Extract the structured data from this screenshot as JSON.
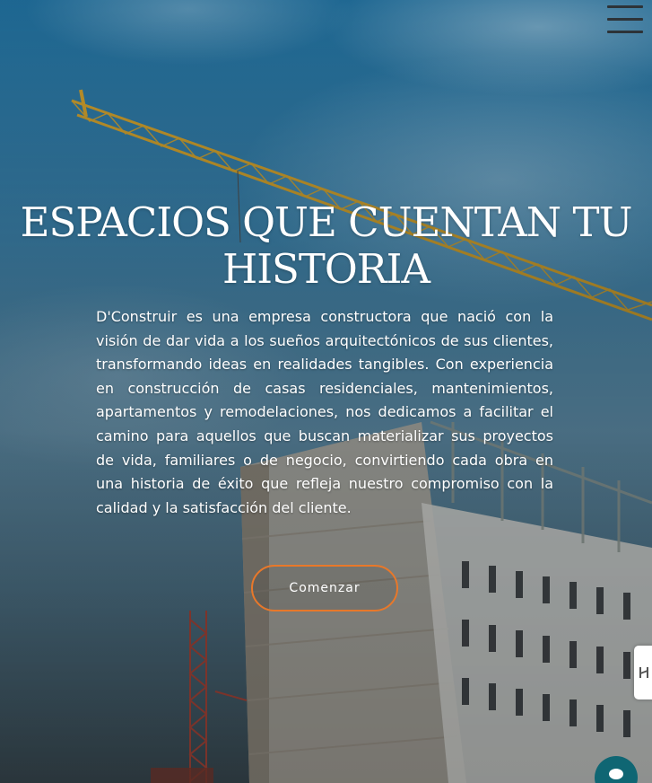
{
  "hero": {
    "title": "ESPACIOS QUE CUENTAN TU HISTORIA",
    "description": "D'Construir es una empresa constructora que nació con la visión de dar vida a los sueños arquitectónicos de sus clientes, transformando ideas en realidades tangibles. Con experiencia en construcción de casas residenciales, mantenimientos, apartamentos y remodelaciones, nos dedicamos a facilitar el camino para aquellos que buscan materializar sus proyectos de vida, familiares o de negocio, convirtiendo cada obra en una historia de éxito que refleja nuestro compromiso con la calidad y la satisfacción del cliente.",
    "cta_label": "Comenzar"
  },
  "icons": {
    "menu": "hamburger-menu-icon",
    "side_tab": "side-tab-icon",
    "chat": "chat-icon"
  },
  "colors": {
    "accent": "#e8782a",
    "menu_lines": "#2d3338",
    "chat_bubble": "#0f6673",
    "text": "#ffffff"
  }
}
